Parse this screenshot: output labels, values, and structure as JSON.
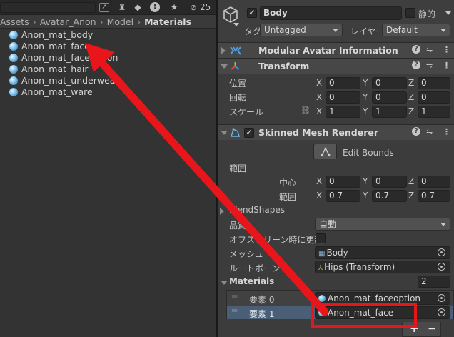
{
  "project": {
    "toolbar_count": "25",
    "breadcrumb": [
      "Assets",
      "Avatar_Anon",
      "Model",
      "Materials"
    ],
    "files": [
      "Anon_mat_body",
      "Anon_mat_face",
      "Anon_mat_faceoption",
      "Anon_mat_hair",
      "Anon_mat_underwear",
      "Anon_mat_ware"
    ]
  },
  "inspector": {
    "object_name": "Body",
    "static_label": "静的",
    "tag_label": "タグ",
    "tag_value": "Untagged",
    "layer_label": "レイヤー",
    "layer_value": "Default",
    "components": {
      "modular_avatar": "Modular Avatar Information",
      "transform": "Transform",
      "skinned": "Skinned Mesh Renderer"
    },
    "transform": {
      "position_label": "位置",
      "rotation_label": "回転",
      "scale_label": "スケール",
      "position": [
        "0",
        "0",
        "0"
      ],
      "rotation": [
        "0",
        "0",
        "0"
      ],
      "scale": [
        "1",
        "1",
        "1"
      ]
    },
    "axes": [
      "X",
      "Y",
      "Z"
    ],
    "skinned": {
      "edit_bounds": "Edit Bounds",
      "bounds_label": "範囲",
      "center_label": "中心",
      "extent_label": "範囲",
      "center": [
        "0",
        "0",
        "0"
      ],
      "extent": [
        "0.7",
        "0.7",
        "0.7"
      ],
      "blendshapes": "BlendShapes",
      "quality_label": "品質",
      "quality_value": "自動",
      "offscreen_label": "オフスクリーン時に更新",
      "mesh_label": "メッシュ",
      "mesh_value": "Body",
      "rootbone_label": "ルートボーン",
      "rootbone_value": "Hips (Transform)"
    },
    "materials": {
      "label": "Materials",
      "count": "2",
      "elements": [
        {
          "label": "要素 0",
          "value": "Anon_mat_faceoption"
        },
        {
          "label": "要素 1",
          "value": "Anon_mat_face"
        }
      ],
      "add": "+",
      "remove": "−"
    }
  },
  "colors": {
    "annotation": "#e8161b",
    "accent_blue": "#7cc0ec"
  }
}
